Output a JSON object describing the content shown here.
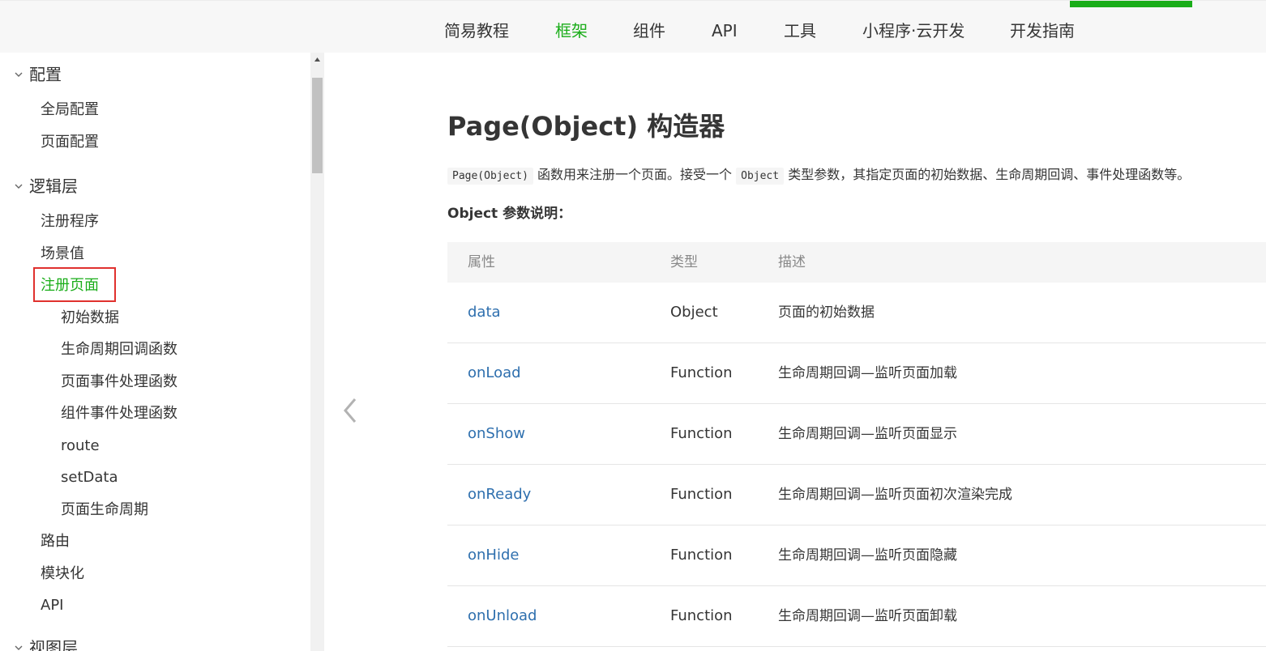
{
  "top_nav": {
    "items": [
      {
        "label": "简易教程",
        "active": false
      },
      {
        "label": "框架",
        "active": true
      },
      {
        "label": "组件",
        "active": false
      },
      {
        "label": "API",
        "active": false
      },
      {
        "label": "工具",
        "active": false
      },
      {
        "label": "小程序·云开发",
        "active": false
      },
      {
        "label": "开发指南",
        "active": false
      }
    ],
    "accent_color": "#1aad19"
  },
  "sidebar": {
    "items": [
      {
        "label": "配置",
        "level": 0,
        "expanded": true
      },
      {
        "label": "全局配置",
        "level": 1
      },
      {
        "label": "页面配置",
        "level": 1
      },
      {
        "label": "逻辑层",
        "level": 0,
        "expanded": true
      },
      {
        "label": "注册程序",
        "level": 1
      },
      {
        "label": "场景值",
        "level": 1
      },
      {
        "label": "注册页面",
        "level": 1,
        "active": true
      },
      {
        "label": "初始数据",
        "level": 2
      },
      {
        "label": "生命周期回调函数",
        "level": 2
      },
      {
        "label": "页面事件处理函数",
        "level": 2
      },
      {
        "label": "组件事件处理函数",
        "level": 2
      },
      {
        "label": "route",
        "level": 2
      },
      {
        "label": "setData",
        "level": 2
      },
      {
        "label": "页面生命周期",
        "level": 2
      },
      {
        "label": "路由",
        "level": 1
      },
      {
        "label": "模块化",
        "level": 1
      },
      {
        "label": "API",
        "level": 1
      },
      {
        "label": "视图层",
        "level": 0,
        "expanded": true
      }
    ],
    "highlight_color": "#e0312e"
  },
  "main": {
    "title": "Page(Object) 构造器",
    "description": {
      "code1": "Page(Object)",
      "text1": "函数用来注册一个页面。接受一个",
      "code2": "Object",
      "text2": "类型参数，其指定页面的初始数据、生命周期回调、事件处理函数等。"
    },
    "section_title": "Object 参数说明：",
    "table": {
      "headers": [
        "属性",
        "类型",
        "描述"
      ],
      "rows": [
        {
          "prop": "data",
          "type": "Object",
          "desc": "页面的初始数据"
        },
        {
          "prop": "onLoad",
          "type": "Function",
          "desc": "生命周期回调—监听页面加载"
        },
        {
          "prop": "onShow",
          "type": "Function",
          "desc": "生命周期回调—监听页面显示"
        },
        {
          "prop": "onReady",
          "type": "Function",
          "desc": "生命周期回调—监听页面初次渲染完成"
        },
        {
          "prop": "onHide",
          "type": "Function",
          "desc": "生命周期回调—监听页面隐藏"
        },
        {
          "prop": "onUnload",
          "type": "Function",
          "desc": "生命周期回调—监听页面卸载"
        }
      ]
    },
    "link_color": "#2e6fae"
  }
}
